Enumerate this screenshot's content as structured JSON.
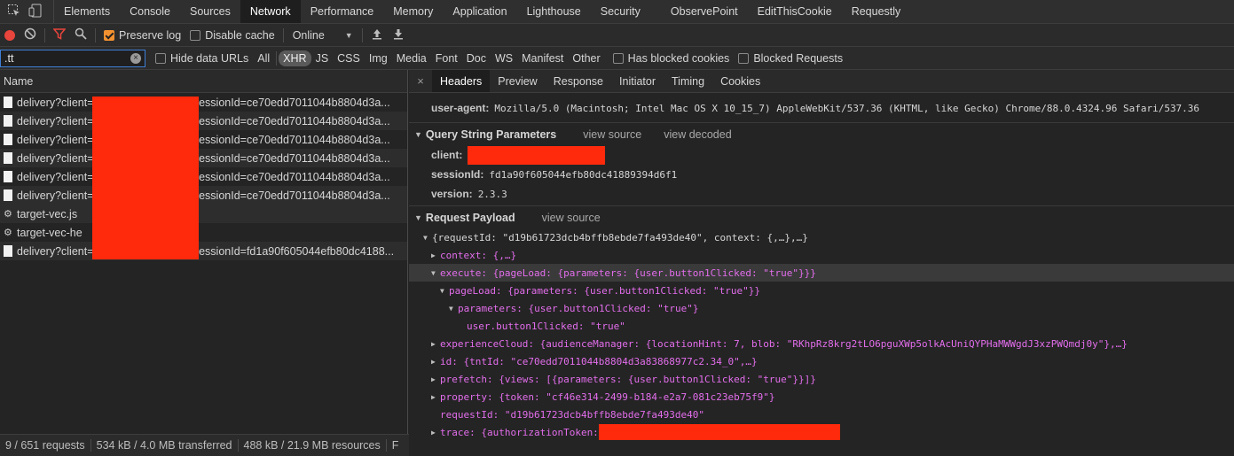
{
  "tabs": [
    "Elements",
    "Console",
    "Sources",
    "Network",
    "Performance",
    "Memory",
    "Application",
    "Lighthouse",
    "Security",
    "ObservePoint",
    "EditThisCookie",
    "Requestly"
  ],
  "active_tab": "Network",
  "toolbar": {
    "preserve_log": "Preserve log",
    "disable_cache": "Disable cache",
    "throttle": "Online"
  },
  "filter": {
    "value": ".tt",
    "hide_data_urls": "Hide data URLs",
    "types": [
      "All",
      "XHR",
      "JS",
      "CSS",
      "Img",
      "Media",
      "Font",
      "Doc",
      "WS",
      "Manifest",
      "Other"
    ],
    "active_type": "XHR",
    "has_blocked_cookies": "Has blocked cookies",
    "blocked_requests": "Blocked Requests"
  },
  "requests": {
    "header": "Name",
    "items": [
      {
        "prefix": "delivery?client=",
        "suffix": "&sessionId=ce70edd7011044b8804d3a...",
        "icon": "document-icon"
      },
      {
        "prefix": "delivery?client=",
        "suffix": "&sessionId=ce70edd7011044b8804d3a...",
        "icon": "document-icon"
      },
      {
        "prefix": "delivery?client=",
        "suffix": "&sessionId=ce70edd7011044b8804d3a...",
        "icon": "document-icon"
      },
      {
        "prefix": "delivery?client=",
        "suffix": "&sessionId=ce70edd7011044b8804d3a...",
        "icon": "document-icon"
      },
      {
        "prefix": "delivery?client=",
        "suffix": "&sessionId=ce70edd7011044b8804d3a...",
        "icon": "document-icon"
      },
      {
        "prefix": "delivery?client=",
        "suffix": "&sessionId=ce70edd7011044b8804d3a...",
        "icon": "document-icon"
      },
      {
        "prefix": "target-vec.js",
        "suffix": "",
        "icon": "gear-icon"
      },
      {
        "prefix": "target-vec-he",
        "suffix": "",
        "icon": "gear-icon"
      },
      {
        "prefix": "delivery?client=",
        "suffix": "&sessionId=fd1a90f605044efb80dc4188...",
        "icon": "document-icon"
      }
    ]
  },
  "footer": {
    "requests": "9 / 651 requests",
    "transferred": "534 kB / 4.0 MB transferred",
    "resources": "488 kB / 21.9 MB resources",
    "truncated": "F"
  },
  "detail_tabs": [
    "Headers",
    "Preview",
    "Response",
    "Initiator",
    "Timing",
    "Cookies"
  ],
  "active_detail_tab": "Headers",
  "headers": {
    "user_agent_key": "user-agent:",
    "user_agent_value": "Mozilla/5.0 (Macintosh; Intel Mac OS X 10_15_7) AppleWebKit/537.36 (KHTML, like Gecko) Chrome/88.0.4324.96 Safari/537.36"
  },
  "query": {
    "title": "Query String Parameters",
    "view_source": "view source",
    "view_decoded": "view decoded",
    "client_key": "client:",
    "session_key": "sessionId:",
    "session_value": "fd1a90f605044efb80dc41889394d6f1",
    "version_key": "version:",
    "version_value": "2.3.3"
  },
  "payload": {
    "title": "Request Payload",
    "view_source": "view source",
    "lines": [
      "{requestId: \"d19b61723dcb4bffb8ebde7fa493de40\", context: {,…},…}",
      "context: {,…}",
      "execute: {pageLoad: {parameters: {user.button1Clicked: \"true\"}}}",
      "pageLoad: {parameters: {user.button1Clicked: \"true\"}}",
      "parameters: {user.button1Clicked: \"true\"}",
      "user.button1Clicked: \"true\"",
      "experienceCloud: {audienceManager: {locationHint: 7, blob: \"RKhpRz8krg2tLO6pguXWp5olkAcUniQYPHaMWWgdJ3xzPWQmdj0y\"},…}",
      "id: {tntId: \"ce70edd7011044b8804d3a83868977c2.34_0\",…}",
      "prefetch: {views: [{parameters: {user.button1Clicked: \"true\"}}]}",
      "property: {token: \"cf46e314-2499-b184-e2a7-081c23eb75f9\"}",
      "requestId: \"d19b61723dcb4bffb8ebde7fa493de40\"",
      "trace: {authorizationToken: "
    ]
  },
  "colors": {
    "redaction": "#ff2a0c",
    "record": "#e8453c",
    "filter_active": "#e8453c",
    "checkbox_on": "#f29130"
  }
}
